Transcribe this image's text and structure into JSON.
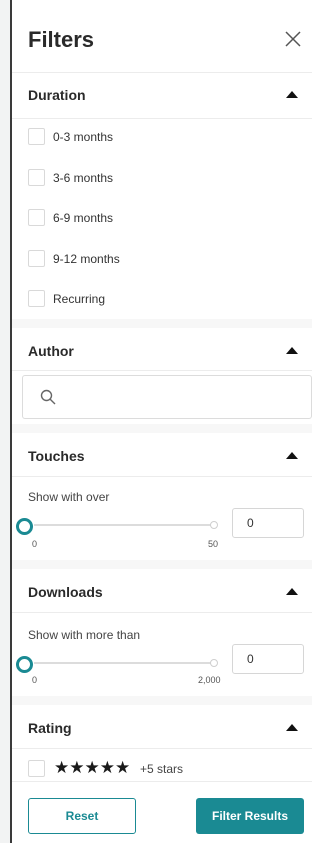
{
  "header": {
    "title": "Filters",
    "close_icon": "close-icon"
  },
  "duration": {
    "label": "Duration",
    "options": [
      "0-3 months",
      "3-6 months",
      "6-9 months",
      "9-12 months",
      "Recurring"
    ]
  },
  "author": {
    "label": "Author",
    "search_placeholder": "",
    "search_value": "",
    "search_icon": "search-icon"
  },
  "touches": {
    "label": "Touches",
    "hint": "Show with over",
    "min_label": "0",
    "max_label": "50",
    "value": "0",
    "slider_fraction": 0
  },
  "downloads": {
    "label": "Downloads",
    "hint": "Show with more than",
    "min_label": "0",
    "max_label": "2,000",
    "value": "0",
    "slider_fraction": 0
  },
  "rating": {
    "label": "Rating",
    "stars": "★★★★★",
    "stars_label": "+5 stars"
  },
  "footer": {
    "reset_label": "Reset",
    "filter_label": "Filter Results"
  },
  "colors": {
    "accent": "#1a8a93",
    "divider": "#ececec"
  }
}
